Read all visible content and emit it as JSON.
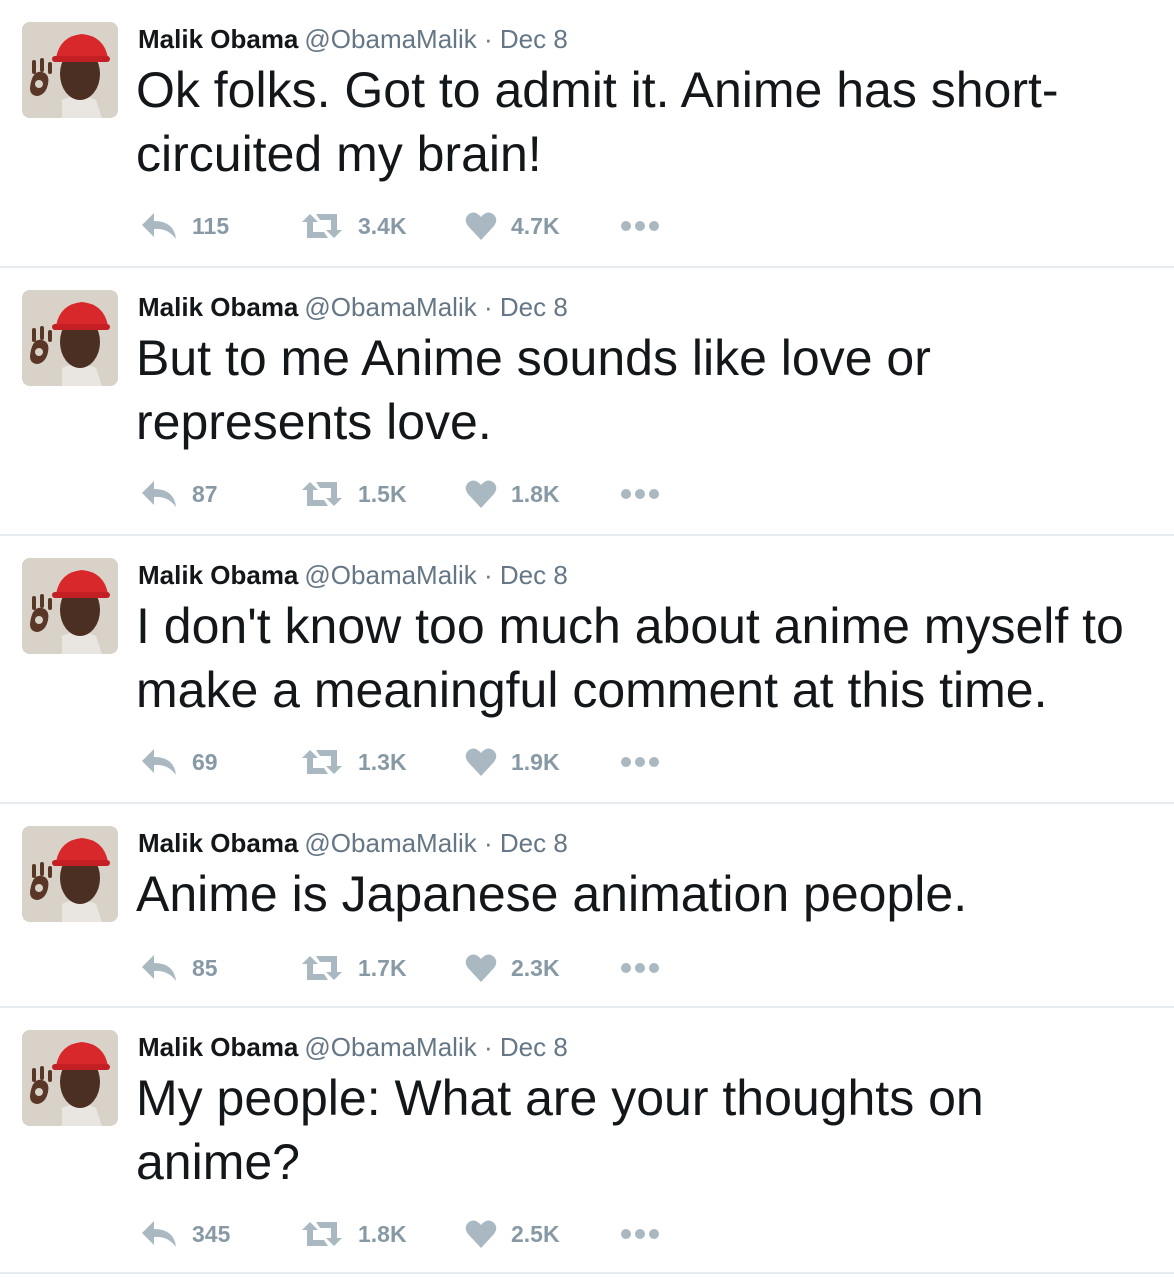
{
  "author": {
    "name": "Malik Obama",
    "handle": "@ObamaMalik",
    "separator": "·"
  },
  "icons": {
    "reply": "reply-arrow-icon",
    "retweet": "retweet-icon",
    "like": "heart-icon",
    "more": "more-dots-icon",
    "action_color": "#aab8c2"
  },
  "tweets": [
    {
      "date": "Dec 8",
      "text": "Ok folks. Got to admit it. Anime has short-circuited my brain!",
      "replies": "115",
      "retweets": "3.4K",
      "likes": "4.7K"
    },
    {
      "date": "Dec 8",
      "text": "But to me Anime sounds like love or represents love.",
      "replies": "87",
      "retweets": "1.5K",
      "likes": "1.8K"
    },
    {
      "date": "Dec 8",
      "text": "I don't know too much about anime myself to make a meaningful comment at this time.",
      "replies": "69",
      "retweets": "1.3K",
      "likes": "1.9K"
    },
    {
      "date": "Dec 8",
      "text": "Anime is Japanese animation people.",
      "replies": "85",
      "retweets": "1.7K",
      "likes": "2.3K"
    },
    {
      "date": "Dec 8",
      "text": "My people: What are your thoughts on anime?",
      "replies": "345",
      "retweets": "1.8K",
      "likes": "2.5K"
    }
  ]
}
